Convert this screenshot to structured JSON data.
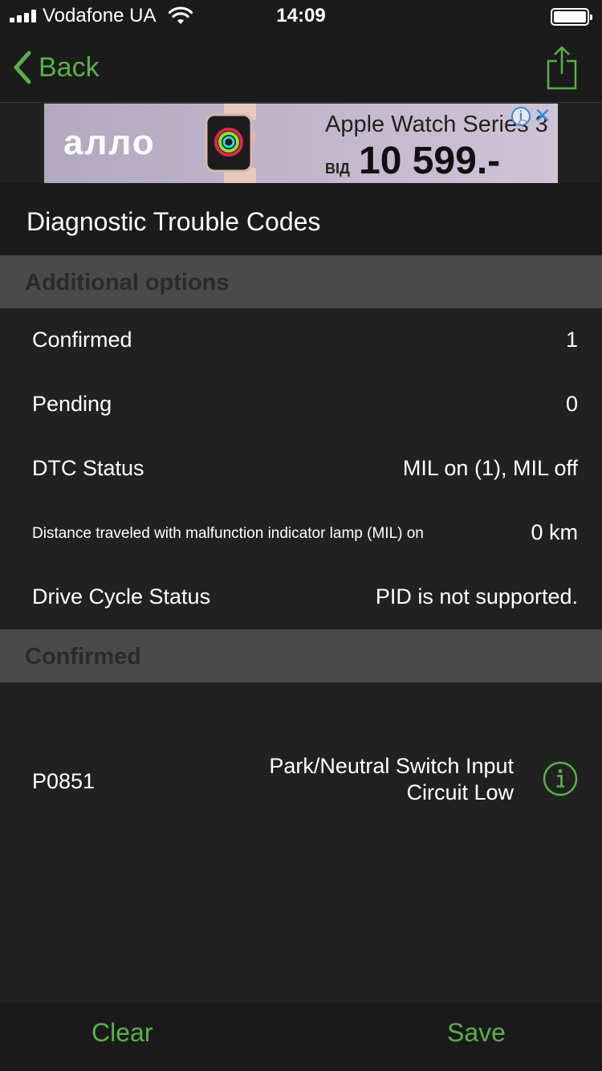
{
  "status_bar": {
    "carrier": "Vodafone UA",
    "time": "14:09",
    "signal_icon": "signal-bars-icon",
    "wifi_icon": "wifi-icon",
    "battery_icon": "battery-icon"
  },
  "nav": {
    "back_label": "Back",
    "back_icon": "chevron-left-icon",
    "share_icon": "share-icon"
  },
  "ad": {
    "brand": "алло",
    "headline": "Apple Watch Series 3",
    "from_label": "ВІД",
    "price": "10 599.-",
    "info_badge": "i",
    "close_label": "✕"
  },
  "page_title": "Diagnostic Trouble Codes",
  "sections": {
    "additional_options": "Additional options",
    "confirmed": "Confirmed"
  },
  "options": [
    {
      "label": "Confirmed",
      "value": "1"
    },
    {
      "label": "Pending",
      "value": "0"
    },
    {
      "label": "DTC Status",
      "value": "MIL on (1), MIL off"
    },
    {
      "label": "Distance traveled with malfunction indicator lamp (MIL) on",
      "value": "0 km"
    },
    {
      "label": "Drive Cycle Status",
      "value": "PID is not supported."
    }
  ],
  "confirmed_codes": [
    {
      "code": "P0851",
      "description": "Park/Neutral Switch Input Circuit Low"
    }
  ],
  "toolbar": {
    "clear_label": "Clear",
    "save_label": "Save"
  },
  "colors": {
    "accent": "#59b04a",
    "background": "#212121",
    "section_header": "#4a4a4a",
    "bar": "#1b1b1b"
  }
}
